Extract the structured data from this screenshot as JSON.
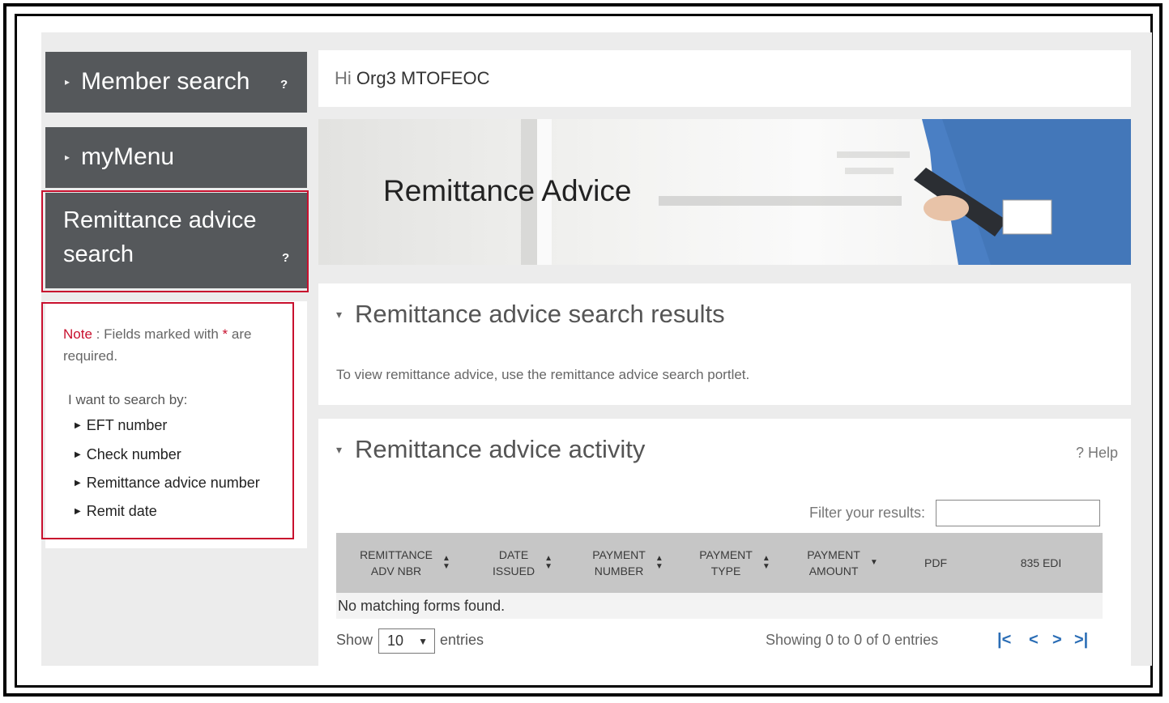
{
  "sidebar": {
    "member_search": "Member search",
    "mymenu": "myMenu",
    "remit_line1": "Remittance advice",
    "remit_line2": "search",
    "help_mark": "?",
    "note_label": "Note",
    "note_text": " : Fields marked with ",
    "note_star": "*",
    "note_are": " are",
    "note_required": "required.",
    "search_by": "I want to search by:",
    "search_options": [
      "EFT number",
      "Check number",
      "Remittance advice number",
      "Remit date"
    ]
  },
  "greeting": {
    "prefix": "Hi ",
    "user": "Org3 MTOFEOC"
  },
  "banner": {
    "title": "Remittance Advice"
  },
  "results": {
    "heading": "Remittance advice search results",
    "message": "To view remittance advice, use the remittance advice search portlet."
  },
  "activity": {
    "heading": "Remittance advice activity",
    "help": "? Help",
    "filter_label": "Filter your results:",
    "columns": [
      {
        "line1": "REMITTANCE",
        "line2": "ADV NBR"
      },
      {
        "line1": "DATE",
        "line2": "ISSUED"
      },
      {
        "line1": "PAYMENT",
        "line2": "NUMBER"
      },
      {
        "line1": "PAYMENT",
        "line2": "TYPE"
      },
      {
        "line1": "PAYMENT",
        "line2": "AMOUNT"
      },
      {
        "line1": "PDF",
        "line2": ""
      },
      {
        "line1": "835 EDI",
        "line2": ""
      }
    ],
    "empty_message": "No matching forms found.",
    "show_label": "Show",
    "show_value": "10",
    "entries_label": "entries",
    "showing_text": "Showing 0 to 0 of 0 entries",
    "pager": {
      "first": "|<",
      "prev": "<",
      "next": ">",
      "last": ">|"
    }
  },
  "colors": {
    "sidebar_tile": "#55585b",
    "highlight_red": "#c8102e",
    "pager_blue": "#2a6db5",
    "table_header": "#c6c6c6"
  }
}
